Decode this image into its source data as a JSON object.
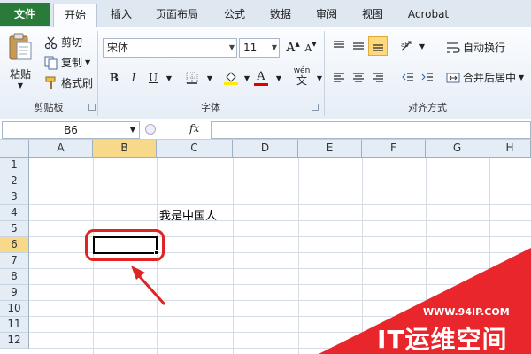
{
  "tabs": [
    "文件",
    "开始",
    "插入",
    "页面布局",
    "公式",
    "数据",
    "审阅",
    "视图",
    "Acrobat"
  ],
  "clipboard": {
    "paste": "粘贴",
    "cut": "剪切",
    "copy": "复制",
    "format_painter": "格式刷",
    "group_label": "剪贴板"
  },
  "font": {
    "name": "宋体",
    "size": "11",
    "bold": "B",
    "italic": "I",
    "underline": "U",
    "grow": "A",
    "shrink": "A",
    "font_color": "A",
    "wen": "wén",
    "group_label": "字体"
  },
  "alignment": {
    "wrap_text": "自动换行",
    "merge_center": "合并后居中",
    "group_label": "对齐方式"
  },
  "formula_bar": {
    "name_box": "B6",
    "fx": "fx",
    "value": ""
  },
  "grid": {
    "columns": [
      "A",
      "B",
      "C",
      "D",
      "E",
      "F",
      "G",
      "H"
    ],
    "rows": [
      "1",
      "2",
      "3",
      "4",
      "5",
      "6",
      "7",
      "8",
      "9",
      "10",
      "11",
      "12"
    ],
    "selected_column": "B",
    "selected_row": "6",
    "active_cell": "B6",
    "cells": {
      "C4": "我是中国人"
    }
  },
  "annotation": {
    "color": "#e02323"
  },
  "watermark": {
    "url": "WWW.94IP.COM",
    "brand": "IT运维空间",
    "color": "#e8262c"
  }
}
